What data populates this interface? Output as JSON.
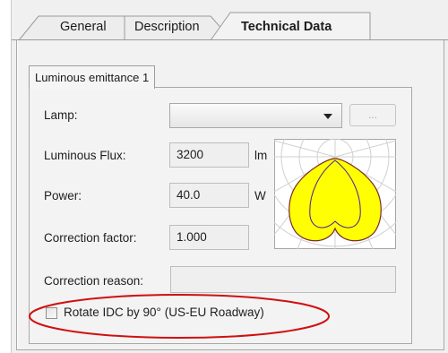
{
  "tabs": [
    {
      "label": "General",
      "active": false
    },
    {
      "label": "Description",
      "active": false
    },
    {
      "label": "Technical Data",
      "active": true
    }
  ],
  "subtab": {
    "label": "Luminous emittance 1"
  },
  "lamp": {
    "label": "Lamp:",
    "value": "",
    "browse_label": "..."
  },
  "luminous_flux": {
    "label": "Luminous Flux:",
    "value": "3200",
    "unit": "lm"
  },
  "power": {
    "label": "Power:",
    "value": "40.0",
    "unit": "W"
  },
  "correction_factor": {
    "label": "Correction factor:",
    "value": "1.000"
  },
  "correction_reason": {
    "label": "Correction reason:",
    "value": ""
  },
  "rotate_checkbox": {
    "label": "Rotate IDC by 90° (US-EU Roadway)",
    "checked": false
  },
  "colors": {
    "highlight": "#d01010",
    "curve_fill": "#ffff00",
    "curve_stroke": "#7a2a2a"
  }
}
